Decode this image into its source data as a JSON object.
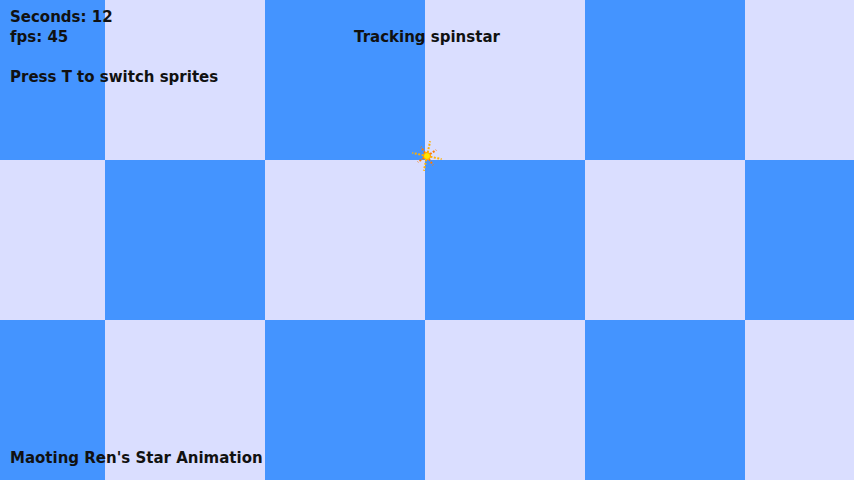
{
  "hud": {
    "seconds": "Seconds: 12",
    "fps": "fps: 45",
    "hint": "Press T to switch sprites"
  },
  "status": "Tracking spinstar",
  "credit": "Maoting Ren's Star Animation"
}
